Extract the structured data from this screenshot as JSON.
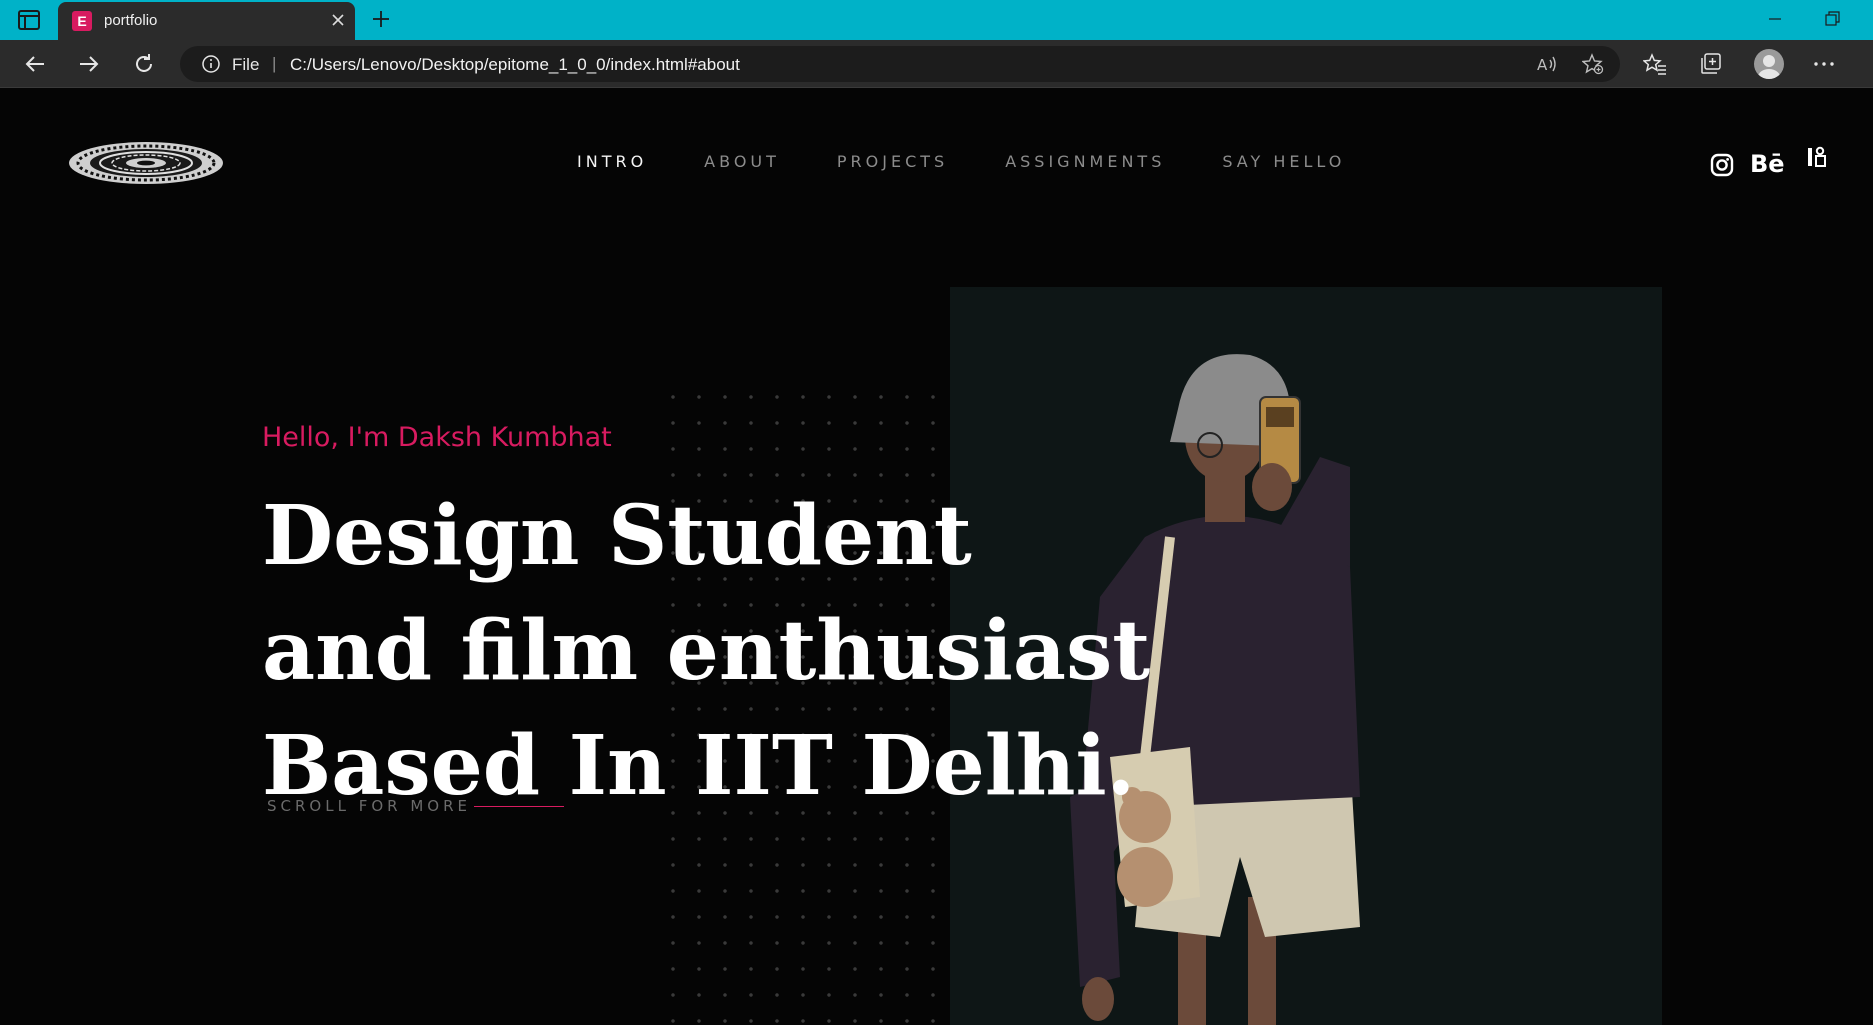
{
  "browser": {
    "tab": {
      "favicon_letter": "E",
      "title": "portfolio"
    },
    "address": {
      "scheme_label": "File",
      "separator": "|",
      "url": "C:/Users/Lenovo/Desktop/epitome_1_0_0/index.html#about"
    }
  },
  "site": {
    "nav": [
      {
        "label": "INTRO",
        "active": true
      },
      {
        "label": "ABOUT",
        "active": false
      },
      {
        "label": "PROJECTS",
        "active": false
      },
      {
        "label": "ASSIGNMENTS",
        "active": false
      },
      {
        "label": "SAY HELLO",
        "active": false
      }
    ],
    "social": [
      "instagram-icon",
      "behance-icon",
      "issuu-icon"
    ],
    "behance_text": "Bē",
    "hero": {
      "greeting": "Hello, I'm Daksh Kumbhat",
      "line1": "Design Student",
      "line2": "and film enthusiast",
      "line3": "Based In IIT Delhi.",
      "scroll_label": "SCROLL FOR MORE"
    },
    "colors": {
      "accent": "#d81b60",
      "background": "#050505",
      "panel": "#0e1616",
      "browser_tabbar": "#00b2c8"
    }
  }
}
